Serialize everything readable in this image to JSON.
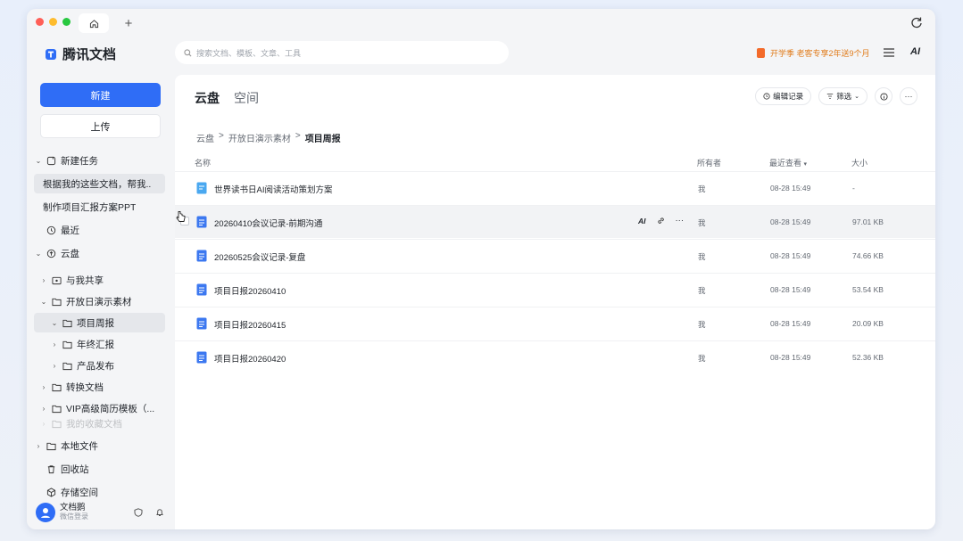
{
  "window": {
    "tabs": [
      {
        "icon": "home-icon"
      }
    ],
    "new_tab_label": "+"
  },
  "sidebar": {
    "brand": "腾讯文档",
    "new_button": "新建",
    "upload_button": "上传",
    "items": [
      {
        "label": "新建任务",
        "icon": "task-icon",
        "chevron": "down"
      },
      {
        "label": "根据我的这些文档，帮我..",
        "selected": true
      },
      {
        "label": "制作项目汇报方案PPT"
      },
      {
        "label": "最近",
        "icon": "clock-icon"
      },
      {
        "label": "云盘",
        "icon": "cloud-icon",
        "chevron": "down"
      },
      {
        "label": "与我共享",
        "icon": "shared-folder-icon",
        "chevron": "right"
      },
      {
        "label": "开放日演示素材",
        "icon": "folder-icon",
        "chevron": "down"
      },
      {
        "label": "项目周报",
        "icon": "folder-icon",
        "chevron": "down",
        "selected": true
      },
      {
        "label": "年终汇报",
        "icon": "folder-icon",
        "chevron": "right"
      },
      {
        "label": "产品发布",
        "icon": "folder-icon",
        "chevron": "right"
      },
      {
        "label": "转换文档",
        "icon": "folder-icon",
        "chevron": "right"
      },
      {
        "label": "VIP高级简历模板（...",
        "icon": "folder-icon",
        "chevron": "right"
      },
      {
        "label": "我的收藏文档",
        "icon": "folder-icon",
        "chevron": "right",
        "faded": true
      },
      {
        "label": "本地文件",
        "icon": "local-folder-icon",
        "chevron": "right"
      },
      {
        "label": "回收站",
        "icon": "trash-icon"
      },
      {
        "label": "存储空间",
        "icon": "storage-icon"
      }
    ],
    "user": {
      "name": "文档鹅",
      "sub": "微信登录"
    }
  },
  "topbar": {
    "search_placeholder": "搜索文档、模板、文章、工具",
    "promo": "开学季 老客专享2年送9个月",
    "ai_label": "AI"
  },
  "main": {
    "tab_active": "云盘",
    "tab_other": "空间",
    "tools": {
      "edit_history": "编辑记录",
      "filter": "筛选"
    },
    "breadcrumb": [
      "云盘",
      "开放日演示素材",
      "项目周报"
    ],
    "columns": {
      "name": "名称",
      "owner": "所有者",
      "recent": "最近查看",
      "size": "大小"
    },
    "rows": [
      {
        "name": "世界读书日AI阅读活动策划方案",
        "owner": "我",
        "recent": "08-28 15:49",
        "size": "-",
        "icon": "smartcanvas-icon"
      },
      {
        "name": "20260410会议记录-前期沟通",
        "owner": "我",
        "recent": "08-28 15:49",
        "size": "97.01 KB",
        "icon": "doc-icon",
        "hovered": true
      },
      {
        "name": "20260525会议记录-复盘",
        "owner": "我",
        "recent": "08-28 15:49",
        "size": "74.66 KB",
        "icon": "doc-icon"
      },
      {
        "name": "项目日报20260410",
        "owner": "我",
        "recent": "08-28 15:49",
        "size": "53.54 KB",
        "icon": "doc-icon"
      },
      {
        "name": "项目日报20260415",
        "owner": "我",
        "recent": "08-28 15:49",
        "size": "20.09 KB",
        "icon": "doc-icon"
      },
      {
        "name": "项目日报20260420",
        "owner": "我",
        "recent": "08-28 15:49",
        "size": "52.36 KB",
        "icon": "doc-icon"
      }
    ],
    "row_actions": {
      "ai": "AI",
      "more": "···"
    }
  },
  "colors": {
    "accent": "#2f6df6",
    "promo": "#e07b1a"
  }
}
